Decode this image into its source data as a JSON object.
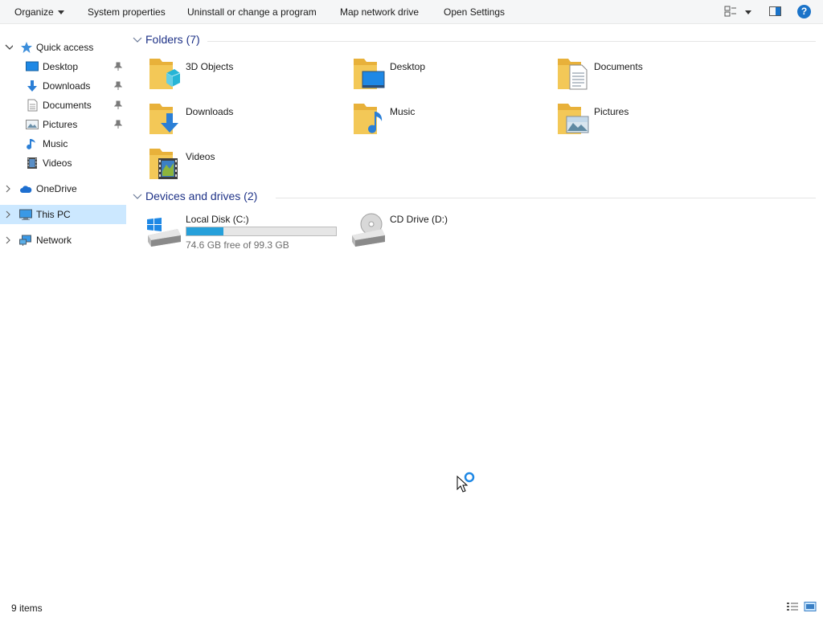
{
  "toolbar": {
    "organize": "Organize",
    "system_properties": "System properties",
    "uninstall": "Uninstall or change a program",
    "map_drive": "Map network drive",
    "open_settings": "Open Settings",
    "help": "?"
  },
  "nav": {
    "quick_access": "Quick access",
    "qa_items": [
      "Desktop",
      "Downloads",
      "Documents",
      "Pictures",
      "Music",
      "Videos"
    ],
    "onedrive": "OneDrive",
    "this_pc": "This PC",
    "network": "Network"
  },
  "folders": {
    "header": "Folders (7)",
    "items": [
      "3D Objects",
      "Desktop",
      "Documents",
      "Downloads",
      "Music",
      "Pictures",
      "Videos"
    ]
  },
  "devices": {
    "header": "Devices and drives (2)",
    "local_disk": {
      "name": "Local Disk (C:)",
      "free_text": "74.6 GB free of 99.3 GB",
      "used_fraction": 0.249
    },
    "cd_drive": {
      "name": "CD Drive (D:)"
    }
  },
  "status": {
    "items": "9 items"
  },
  "colors": {
    "accent": "#1a73c9",
    "selected": "#cce8ff",
    "folder": "#f3c24b",
    "drive_fill": "#26a0da"
  }
}
